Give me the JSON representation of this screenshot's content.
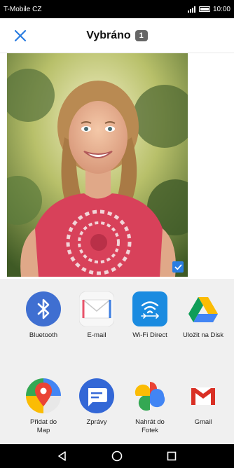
{
  "status": {
    "carrier": "T-Mobile CZ",
    "time": "10:00"
  },
  "header": {
    "title": "Vybráno",
    "count": "1"
  },
  "share_apps": [
    {
      "label": "Bluetooth",
      "icon": "bluetooth-icon"
    },
    {
      "label": "E-mail",
      "icon": "email-icon"
    },
    {
      "label": "Wi-Fi Direct",
      "icon": "wifi-direct-icon"
    },
    {
      "label": "Uložit na Disk",
      "icon": "google-drive-icon"
    },
    {
      "label": "Přidat do Map",
      "icon": "google-maps-icon"
    },
    {
      "label": "Zprávy",
      "icon": "messages-icon"
    },
    {
      "label": "Nahrát do Fotek",
      "icon": "google-photos-icon"
    },
    {
      "label": "Gmail",
      "icon": "gmail-icon"
    }
  ],
  "colors": {
    "accent": "#2a7de1",
    "sheet_bg": "#f0f0f0"
  }
}
